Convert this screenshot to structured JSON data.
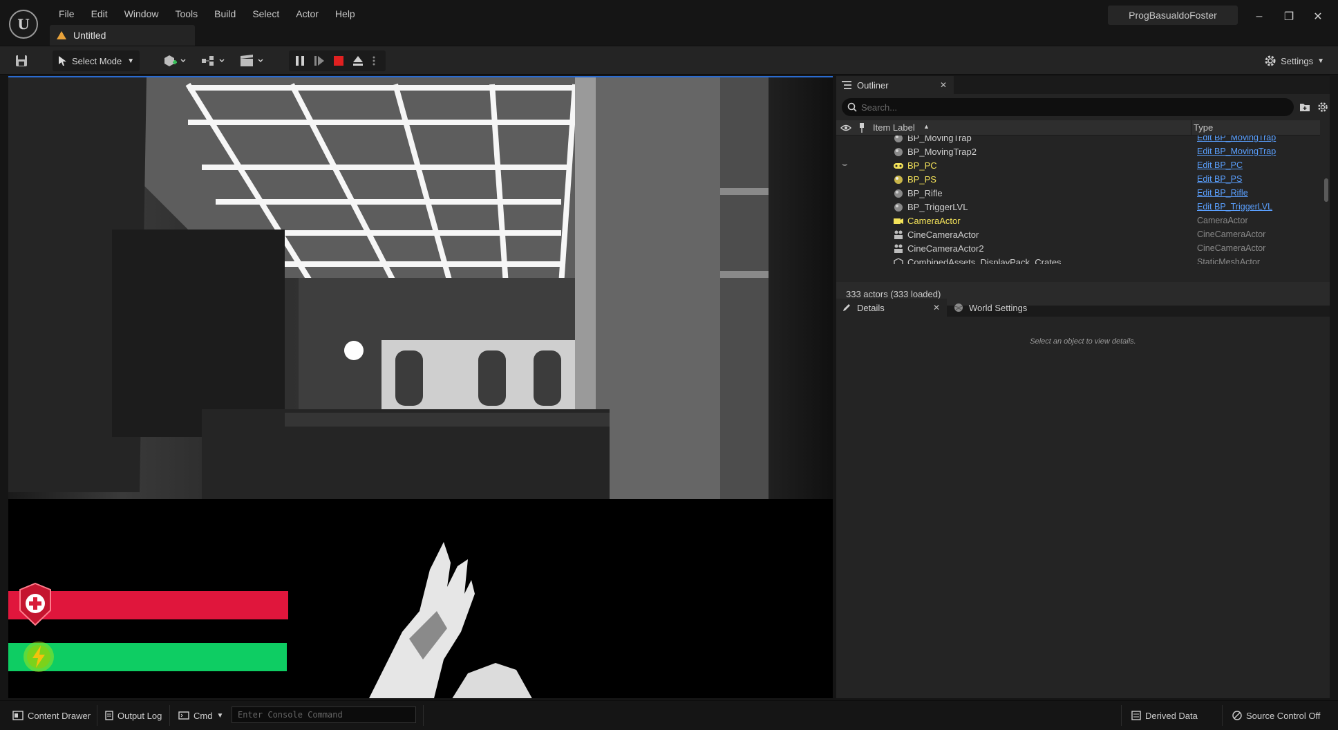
{
  "menu": [
    "File",
    "Edit",
    "Window",
    "Tools",
    "Build",
    "Select",
    "Actor",
    "Help"
  ],
  "document_tab": "Untitled",
  "user": "ProgBasualdoFoster",
  "toolbar": {
    "select_mode": "Select Mode",
    "settings": "Settings"
  },
  "outliner": {
    "tab": "Outliner",
    "search_placeholder": "Search...",
    "col_label": "Item Label",
    "col_type": "Type",
    "rows": [
      {
        "name": "BP_MovingTrap",
        "type": "Edit BP_MovingTrap"
      },
      {
        "name": "BP_MovingTrap2",
        "type": "Edit BP_MovingTrap"
      },
      {
        "name": "BP_PC",
        "type": "Edit BP_PC"
      },
      {
        "name": "BP_PS",
        "type": "Edit BP_PS"
      },
      {
        "name": "BP_Rifle",
        "type": "Edit BP_Rifle"
      },
      {
        "name": "BP_TriggerLVL",
        "type": "Edit BP_TriggerLVL"
      },
      {
        "name": "CameraActor",
        "type": "CameraActor"
      },
      {
        "name": "CineCameraActor",
        "type": "CineCameraActor"
      },
      {
        "name": "CineCameraActor2",
        "type": "CineCameraActor"
      },
      {
        "name": "CombinedAssets_DisplayPack_Crates",
        "type": "StaticMeshActor"
      }
    ],
    "actor_count": "333 actors (333 loaded)"
  },
  "details": {
    "tab": "Details",
    "world_tab": "World Settings",
    "empty_msg": "Select an object to view details."
  },
  "statusbar": {
    "content_drawer": "Content Drawer",
    "output_log": "Output Log",
    "cmd": "Cmd",
    "console_placeholder": "Enter Console Command",
    "derived_data": "Derived Data",
    "source_control": "Source Control Off"
  },
  "colors": {
    "health": "#e0163c",
    "energy": "#0ecd63",
    "link": "#5aa0ff",
    "highlight": "#f4e35a"
  }
}
